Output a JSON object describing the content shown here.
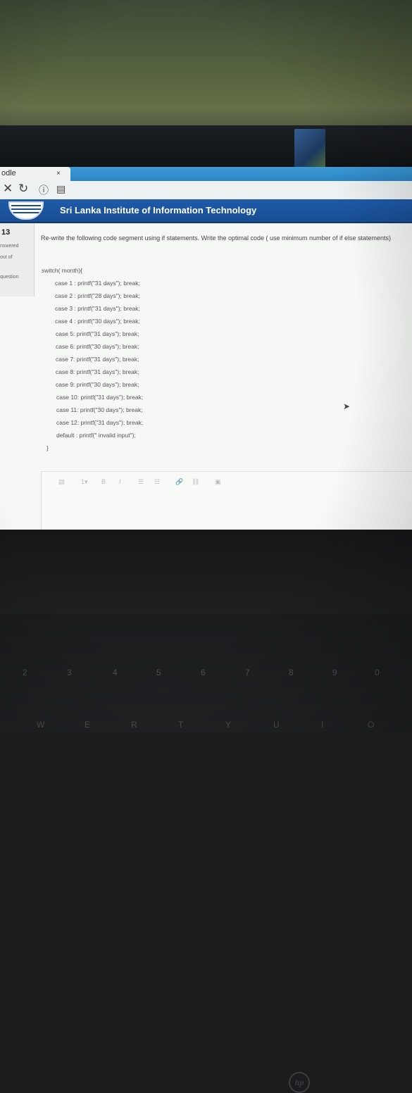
{
  "browser": {
    "tab_title": "odle",
    "tab_close": "×",
    "nav_close": "✕",
    "nav_reload": "↻",
    "nav_info": "ⓘ",
    "nav_page": "▤"
  },
  "site": {
    "title": "Sri Lanka Institute of Information Technology"
  },
  "question_info": {
    "number": "13",
    "status": "nswered",
    "mark": "out of",
    "flag": "question"
  },
  "question": {
    "text": "Re-write the following code segment using if statements. Write the optimal code ( use minimum number of if else statements)",
    "code_lines": [
      "switch( month){",
      "case 1 : printf(\"31 days\"); break;",
      "case 2 : printf(\"28 days\"); break;",
      "case 3 : printf(\"31 days\"); break;",
      "case 4 : printf(\"30 days\"); break;",
      "case 5: printf(\"31 days\"); break;",
      "case 6: printf(\"30 days\"); break;",
      "case 7: printf(\"31 days\"); break;",
      "case 8: printf(\"31 days\"); break;",
      "case 9: printf(\"30 days\"); break;",
      "case 10: printf(\"31 days\"); break;",
      "case 11: printf(\"30 days\"); break;",
      "case 12: printf(\"31 days\"); break;",
      "default : printf(\" invalid input\");",
      "}"
    ]
  },
  "editor_toolbar": {
    "format": "▤",
    "heading": "1▾",
    "bold": "B",
    "italic": "I",
    "bullets": "☰",
    "numbered": "☷",
    "link": "🔗",
    "unlink": "⛓",
    "image": "▣"
  },
  "laptop": {
    "brand": "hp",
    "number_keys": [
      "2",
      "3",
      "4",
      "5",
      "6",
      "7",
      "8",
      "9",
      "0"
    ],
    "letter_keys": [
      "W",
      "E",
      "R",
      "T",
      "Y",
      "U",
      "I",
      "O"
    ]
  }
}
